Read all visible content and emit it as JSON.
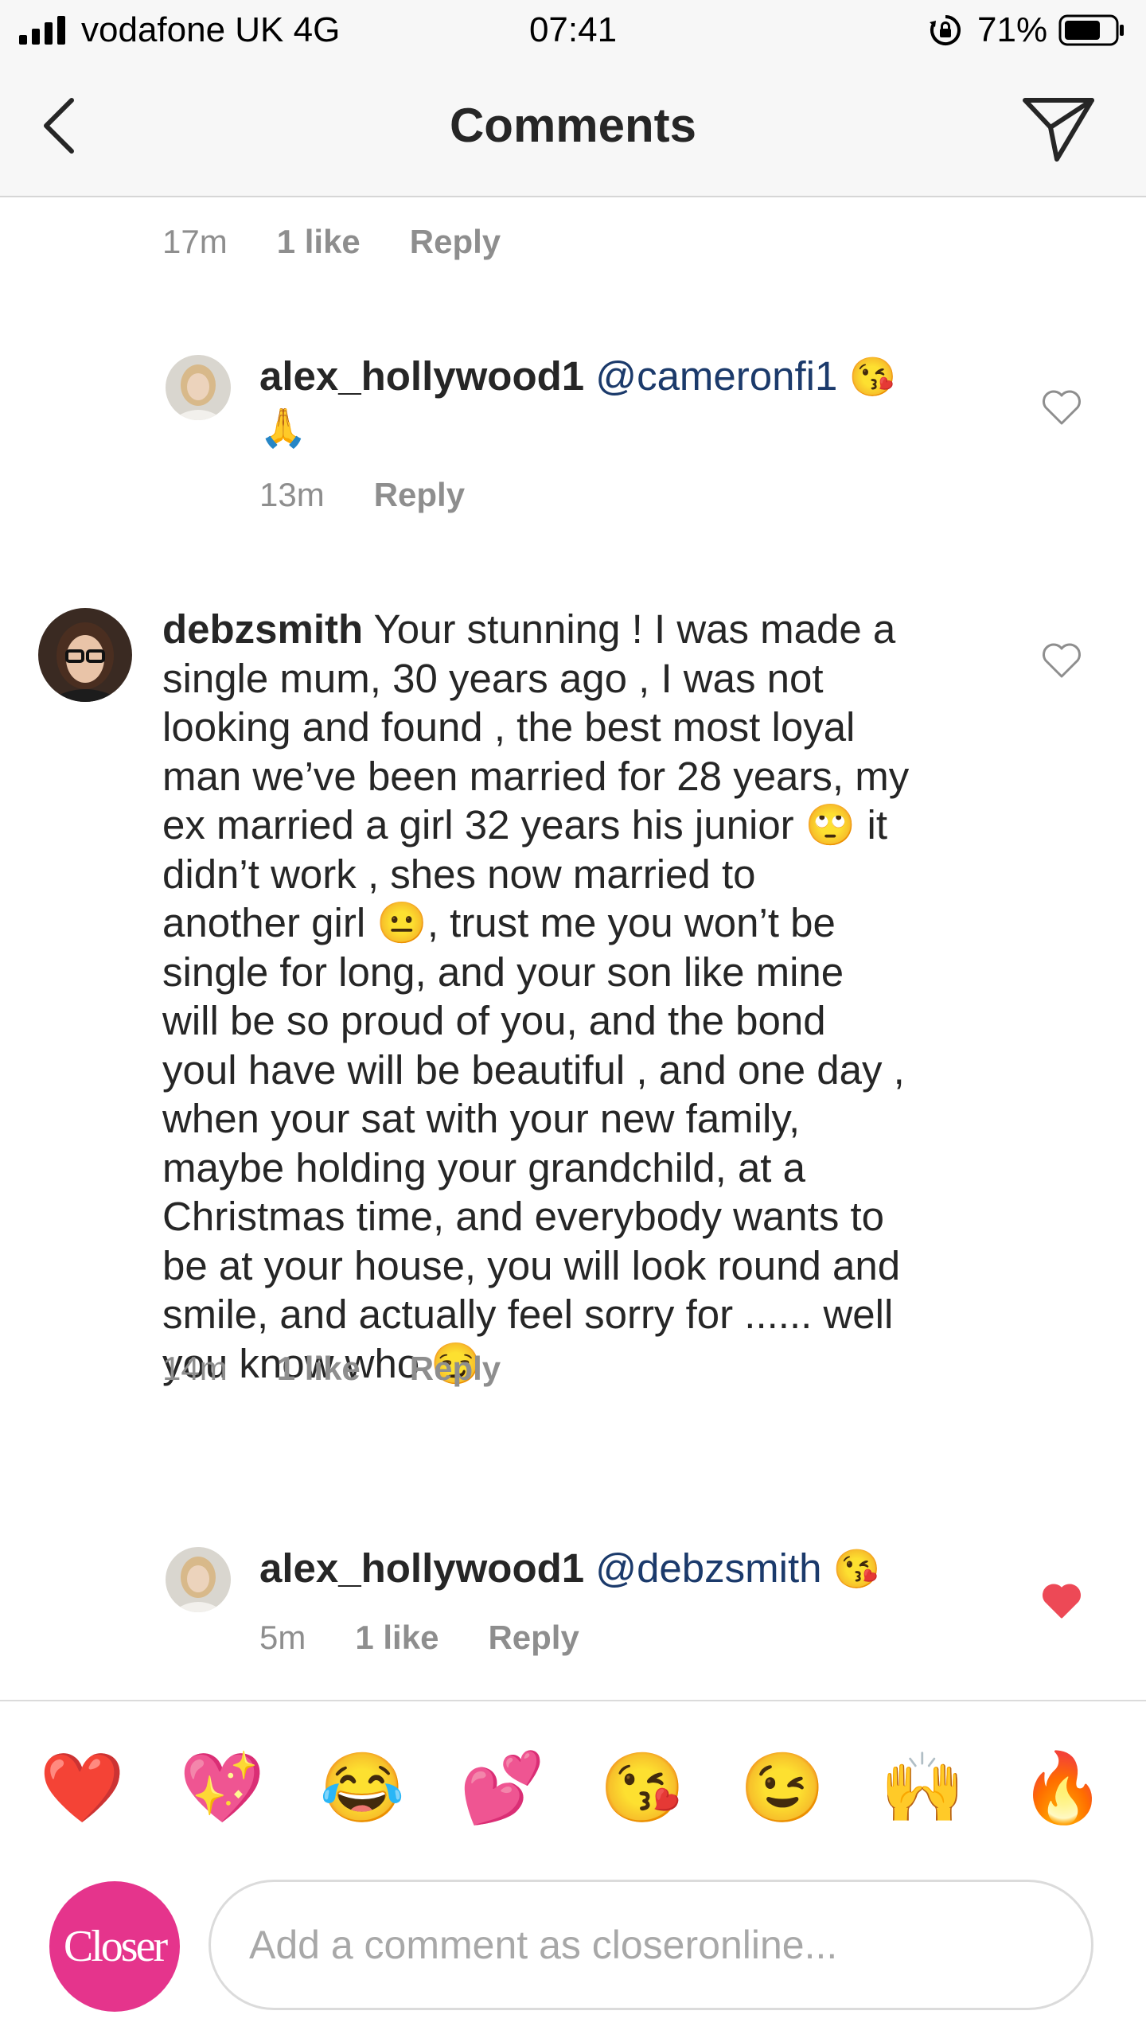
{
  "status_bar": {
    "carrier": "vodafone UK  4G",
    "time": "07:41",
    "battery": "71%"
  },
  "nav": {
    "title": "Comments",
    "back_icon": "chevron-left-icon",
    "share_icon": "paper-plane-icon"
  },
  "comments": [
    {
      "id": "c0",
      "time": "17m",
      "likes": "1 like",
      "reply": "Reply"
    },
    {
      "id": "c1",
      "username": "alex_hollywood1",
      "mention": "@cameronfi1",
      "emojis": [
        "😘",
        "🙏"
      ],
      "time": "13m",
      "reply": "Reply",
      "liked": false
    },
    {
      "id": "c2",
      "username": "debzsmith",
      "text_lines": [
        "Your stunning ! I was made a",
        "single mum, 30 years ago , I was not",
        "looking and found , the best most loyal",
        "man we’ve been married for 28 years, my",
        "ex married a girl 32 years his junior 🙄 it",
        "didn’t work , shes now married to",
        "another girl 😐, trust me you won’t be",
        "single for long, and your son like mine",
        "will be so proud of you, and the bond",
        "youl have will be beautiful , and one day ,",
        "when your sat with your new family,",
        "maybe holding your grandchild, at a",
        "Christmas time, and everybody wants to",
        "be at your house, you will look round and",
        "smile, and actually feel sorry for ...... well",
        "you know who 😏"
      ],
      "time": "14m",
      "likes": "1 like",
      "reply": "Reply",
      "liked": false
    },
    {
      "id": "c3",
      "username": "alex_hollywood1",
      "mention": "@debzsmith",
      "emojis": [
        "😘"
      ],
      "time": "5m",
      "likes": "1 like",
      "reply": "Reply",
      "liked": true,
      "liked_color": "#ed4956"
    }
  ],
  "reactions": [
    "❤️",
    "💖",
    "😂",
    "💕",
    "😘",
    "😉",
    "🙌",
    "🔥"
  ],
  "composer": {
    "avatar_label": "Closer",
    "avatar_color": "#e5348c",
    "placeholder": "Add a comment as closeronline..."
  }
}
